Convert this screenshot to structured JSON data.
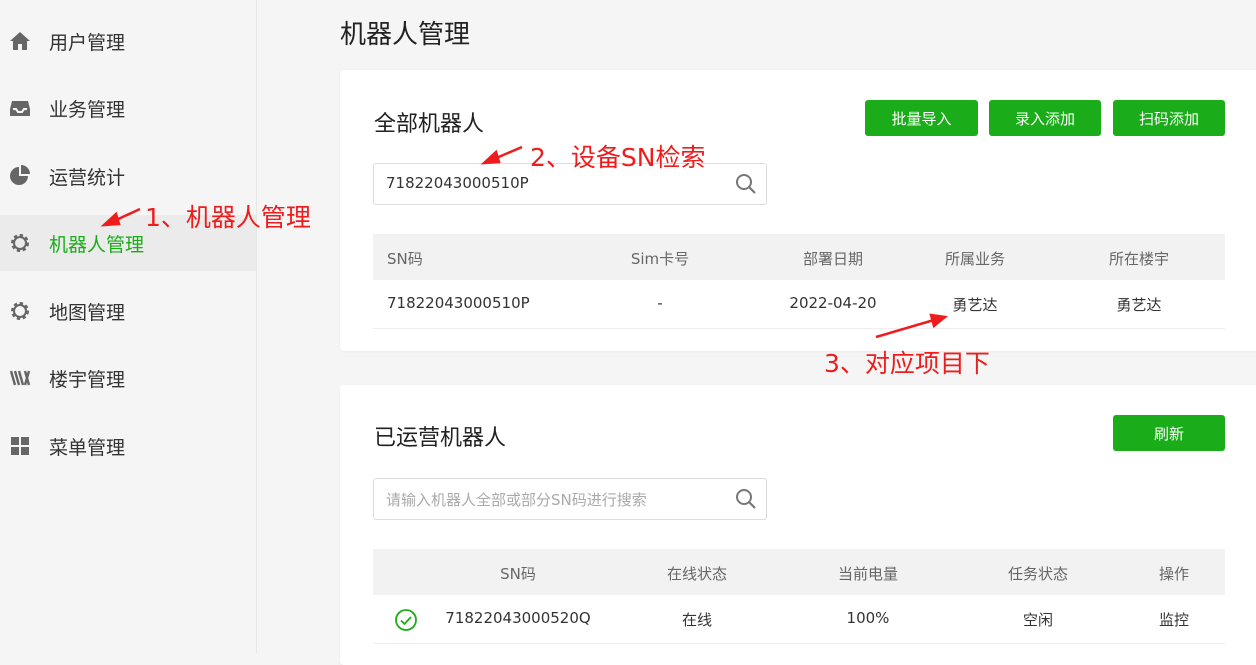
{
  "sidebar": {
    "items": [
      {
        "label": "用户管理",
        "icon": "home-icon"
      },
      {
        "label": "业务管理",
        "icon": "inbox-icon"
      },
      {
        "label": "运营统计",
        "icon": "pie-chart-icon"
      },
      {
        "label": "机器人管理",
        "icon": "gear-icon",
        "active": true
      },
      {
        "label": "地图管理",
        "icon": "gear-icon"
      },
      {
        "label": "楼宇管理",
        "icon": "building-icon"
      },
      {
        "label": "菜单管理",
        "icon": "grid-icon"
      }
    ]
  },
  "page": {
    "title": "机器人管理"
  },
  "all_robots": {
    "title": "全部机器人",
    "buttons": {
      "batch_import": "批量导入",
      "manual_add": "录入添加",
      "scan_add": "扫码添加"
    },
    "search": {
      "value": "71822043000510P"
    },
    "columns": [
      "SN码",
      "Sim卡号",
      "部署日期",
      "所属业务",
      "所在楼宇"
    ],
    "rows": [
      {
        "sn": "71822043000510P",
        "sim": "-",
        "date": "2022-04-20",
        "business": "勇艺达",
        "building": "勇艺达"
      }
    ]
  },
  "operating_robots": {
    "title": "已运营机器人",
    "refresh": "刷新",
    "search": {
      "placeholder": "请输入机器人全部或部分SN码进行搜索"
    },
    "columns": [
      "SN码",
      "在线状态",
      "当前电量",
      "任务状态",
      "操作"
    ],
    "rows": [
      {
        "sn": "71822043000520Q",
        "online": "在线",
        "battery": "100%",
        "task": "空闲",
        "action": "监控"
      }
    ]
  },
  "annotations": {
    "a1": "1、机器人管理",
    "a2": "2、设备SN检索",
    "a3": "3、对应项目下"
  },
  "colors": {
    "accent": "#1aad19",
    "annotation": "#ee1c1c"
  }
}
